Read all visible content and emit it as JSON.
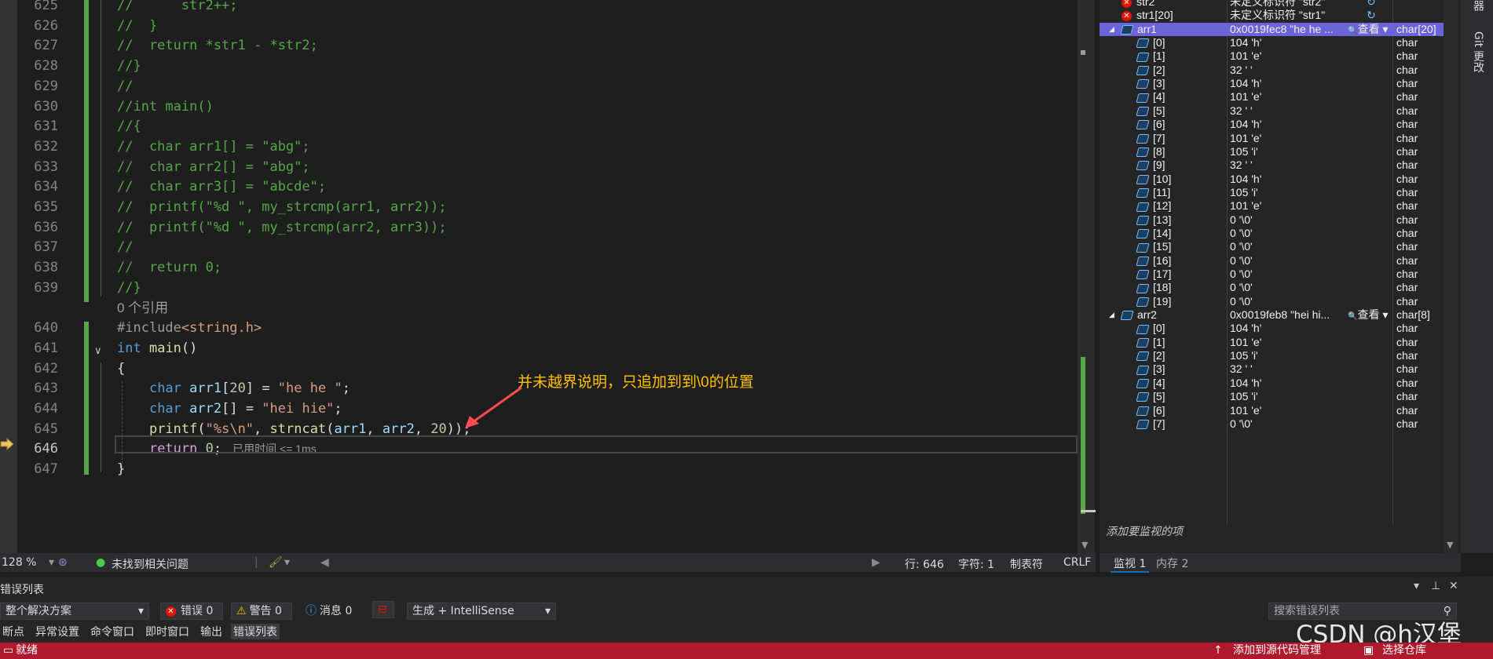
{
  "editor": {
    "lines": [
      {
        "no": "625",
        "segs": [
          {
            "c": "com",
            "t": "//      str2++;"
          }
        ]
      },
      {
        "no": "626",
        "segs": [
          {
            "c": "com",
            "t": "//  }"
          }
        ]
      },
      {
        "no": "627",
        "segs": [
          {
            "c": "com",
            "t": "//  return *str1 - *str2;"
          }
        ]
      },
      {
        "no": "628",
        "segs": [
          {
            "c": "com",
            "t": "//}"
          }
        ]
      },
      {
        "no": "629",
        "segs": [
          {
            "c": "com",
            "t": "//"
          }
        ]
      },
      {
        "no": "630",
        "segs": [
          {
            "c": "com",
            "t": "//int main()"
          }
        ]
      },
      {
        "no": "631",
        "segs": [
          {
            "c": "com",
            "t": "//{"
          }
        ]
      },
      {
        "no": "632",
        "segs": [
          {
            "c": "com",
            "t": "//  char arr1[] = \"abg\";"
          }
        ]
      },
      {
        "no": "633",
        "segs": [
          {
            "c": "com",
            "t": "//  char arr2[] = \"abg\";"
          }
        ]
      },
      {
        "no": "634",
        "segs": [
          {
            "c": "com",
            "t": "//  char arr3[] = \"abcde\";"
          }
        ]
      },
      {
        "no": "635",
        "segs": [
          {
            "c": "com",
            "t": "//  printf(\"%d \", my_strcmp(arr1, arr2));"
          }
        ]
      },
      {
        "no": "636",
        "segs": [
          {
            "c": "com",
            "t": "//  printf(\"%d \", my_strcmp(arr2, arr3));"
          }
        ]
      },
      {
        "no": "637",
        "segs": [
          {
            "c": "com",
            "t": "//"
          }
        ]
      },
      {
        "no": "638",
        "segs": [
          {
            "c": "com",
            "t": "//  return 0;"
          }
        ]
      },
      {
        "no": "639",
        "segs": [
          {
            "c": "com",
            "t": "//}"
          }
        ]
      },
      {
        "no": "",
        "lens": "0 个引用"
      },
      {
        "no": "640",
        "segs": [
          {
            "c": "pp",
            "t": "#include"
          },
          {
            "c": "str",
            "t": "<string.h>"
          }
        ]
      },
      {
        "no": "641",
        "segs": [
          {
            "c": "kw",
            "t": "int"
          },
          {
            "c": "plain",
            "t": " "
          },
          {
            "c": "fn",
            "t": "main"
          },
          {
            "c": "plain",
            "t": "()"
          }
        ]
      },
      {
        "no": "642",
        "segs": [
          {
            "c": "plain",
            "t": "{"
          }
        ]
      },
      {
        "no": "643",
        "segs": [
          {
            "c": "plain",
            "t": "    "
          },
          {
            "c": "kw",
            "t": "char"
          },
          {
            "c": "plain",
            "t": " "
          },
          {
            "c": "var",
            "t": "arr1"
          },
          {
            "c": "plain",
            "t": "["
          },
          {
            "c": "num",
            "t": "20"
          },
          {
            "c": "plain",
            "t": "] = "
          },
          {
            "c": "str",
            "t": "\"he he \""
          },
          {
            "c": "plain",
            "t": ";"
          }
        ]
      },
      {
        "no": "644",
        "segs": [
          {
            "c": "plain",
            "t": "    "
          },
          {
            "c": "kw",
            "t": "char"
          },
          {
            "c": "plain",
            "t": " "
          },
          {
            "c": "var",
            "t": "arr2"
          },
          {
            "c": "plain",
            "t": "[] = "
          },
          {
            "c": "str",
            "t": "\"hei hie\""
          },
          {
            "c": "plain",
            "t": ";"
          }
        ]
      },
      {
        "no": "645",
        "segs": [
          {
            "c": "plain",
            "t": "    "
          },
          {
            "c": "fn",
            "t": "printf"
          },
          {
            "c": "plain",
            "t": "("
          },
          {
            "c": "str",
            "t": "\"%s\\n\""
          },
          {
            "c": "plain",
            "t": ", "
          },
          {
            "c": "fn",
            "t": "strncat"
          },
          {
            "c": "plain",
            "t": "("
          },
          {
            "c": "var",
            "t": "arr1"
          },
          {
            "c": "plain",
            "t": ", "
          },
          {
            "c": "var",
            "t": "arr2"
          },
          {
            "c": "plain",
            "t": ", "
          },
          {
            "c": "num",
            "t": "20"
          },
          {
            "c": "plain",
            "t": "));"
          }
        ]
      },
      {
        "no": "646",
        "current": true,
        "segs": [
          {
            "c": "plain",
            "t": "    "
          },
          {
            "c": "ctl",
            "t": "return"
          },
          {
            "c": "plain",
            "t": " "
          },
          {
            "c": "num",
            "t": "0"
          },
          {
            "c": "plain",
            "t": ";"
          }
        ],
        "elapsed": "已用时间 <= 1ms"
      },
      {
        "no": "647",
        "segs": [
          {
            "c": "plain",
            "t": "}"
          }
        ]
      }
    ],
    "annotation": "并未越界说明，只追加到到\\0的位置"
  },
  "editor_status": {
    "zoom": "128 %",
    "issues": "未找到相关问题",
    "line": "行: 646",
    "char": "字符: 1",
    "tabs": "制表符",
    "eol": "CRLF"
  },
  "watch": {
    "rows": [
      {
        "indent": 0,
        "icon": "error",
        "name": "str2",
        "value": "未定义标识符 \"str2\"",
        "type": "",
        "refresh": true
      },
      {
        "indent": 0,
        "icon": "error",
        "name": "str1[20]",
        "value": "未定义标识符 \"str1\"",
        "type": "",
        "refresh": true
      },
      {
        "indent": 0,
        "icon": "var",
        "expander": "◢",
        "name": "arr1",
        "value": "0x0019fec8 \"he he ...",
        "type": "char[20]",
        "selected": true,
        "view": "查看"
      },
      {
        "indent": 1,
        "icon": "var",
        "name": "[0]",
        "value": "104 'h'",
        "type": "char"
      },
      {
        "indent": 1,
        "icon": "var",
        "name": "[1]",
        "value": "101 'e'",
        "type": "char"
      },
      {
        "indent": 1,
        "icon": "var",
        "name": "[2]",
        "value": "32 ' '",
        "type": "char"
      },
      {
        "indent": 1,
        "icon": "var",
        "name": "[3]",
        "value": "104 'h'",
        "type": "char"
      },
      {
        "indent": 1,
        "icon": "var",
        "name": "[4]",
        "value": "101 'e'",
        "type": "char"
      },
      {
        "indent": 1,
        "icon": "var",
        "name": "[5]",
        "value": "32 ' '",
        "type": "char"
      },
      {
        "indent": 1,
        "icon": "var",
        "name": "[6]",
        "value": "104 'h'",
        "type": "char"
      },
      {
        "indent": 1,
        "icon": "var",
        "name": "[7]",
        "value": "101 'e'",
        "type": "char"
      },
      {
        "indent": 1,
        "icon": "var",
        "name": "[8]",
        "value": "105 'i'",
        "type": "char"
      },
      {
        "indent": 1,
        "icon": "var",
        "name": "[9]",
        "value": "32 ' '",
        "type": "char"
      },
      {
        "indent": 1,
        "icon": "var",
        "name": "[10]",
        "value": "104 'h'",
        "type": "char"
      },
      {
        "indent": 1,
        "icon": "var",
        "name": "[11]",
        "value": "105 'i'",
        "type": "char"
      },
      {
        "indent": 1,
        "icon": "var",
        "name": "[12]",
        "value": "101 'e'",
        "type": "char"
      },
      {
        "indent": 1,
        "icon": "var",
        "name": "[13]",
        "value": "0 '\\0'",
        "type": "char"
      },
      {
        "indent": 1,
        "icon": "var",
        "name": "[14]",
        "value": "0 '\\0'",
        "type": "char"
      },
      {
        "indent": 1,
        "icon": "var",
        "name": "[15]",
        "value": "0 '\\0'",
        "type": "char"
      },
      {
        "indent": 1,
        "icon": "var",
        "name": "[16]",
        "value": "0 '\\0'",
        "type": "char"
      },
      {
        "indent": 1,
        "icon": "var",
        "name": "[17]",
        "value": "0 '\\0'",
        "type": "char"
      },
      {
        "indent": 1,
        "icon": "var",
        "name": "[18]",
        "value": "0 '\\0'",
        "type": "char"
      },
      {
        "indent": 1,
        "icon": "var",
        "name": "[19]",
        "value": "0 '\\0'",
        "type": "char"
      },
      {
        "indent": 0,
        "icon": "var",
        "expander": "◢",
        "name": "arr2",
        "value": "0x0019feb8 \"hei hi...",
        "type": "char[8]",
        "view": "查看"
      },
      {
        "indent": 1,
        "icon": "var",
        "name": "[0]",
        "value": "104 'h'",
        "type": "char"
      },
      {
        "indent": 1,
        "icon": "var",
        "name": "[1]",
        "value": "101 'e'",
        "type": "char"
      },
      {
        "indent": 1,
        "icon": "var",
        "name": "[2]",
        "value": "105 'i'",
        "type": "char"
      },
      {
        "indent": 1,
        "icon": "var",
        "name": "[3]",
        "value": "32 ' '",
        "type": "char"
      },
      {
        "indent": 1,
        "icon": "var",
        "name": "[4]",
        "value": "104 'h'",
        "type": "char"
      },
      {
        "indent": 1,
        "icon": "var",
        "name": "[5]",
        "value": "105 'i'",
        "type": "char"
      },
      {
        "indent": 1,
        "icon": "var",
        "name": "[6]",
        "value": "101 'e'",
        "type": "char"
      },
      {
        "indent": 1,
        "icon": "var",
        "name": "[7]",
        "value": "0 '\\0'",
        "type": "char"
      }
    ],
    "add_placeholder": "添加要监视的项",
    "tabs": [
      "监视 1",
      "内存 2"
    ]
  },
  "right_strip": {
    "items": [
      "器",
      "Git 更改"
    ]
  },
  "error_list": {
    "title": "错误列表",
    "scope": "整个解决方案",
    "errors": "错误 0",
    "warnings": "警告 0",
    "messages": "消息 0",
    "build": "生成 + IntelliSense",
    "search": "搜索错误列表",
    "bottom_tabs": [
      "断点",
      "异常设置",
      "命令窗口",
      "即时窗口",
      "输出",
      "错误列表"
    ]
  },
  "statusbar": {
    "ready": "就绪",
    "add_source": "添加到源代码管理",
    "select_repo": "选择仓库"
  },
  "watermark": "CSDN @h汉堡",
  "colors": {
    "accent": "#b0182d",
    "selection": "#6b64d8",
    "annotation": "#ffc000",
    "comment": "#57a64a"
  }
}
